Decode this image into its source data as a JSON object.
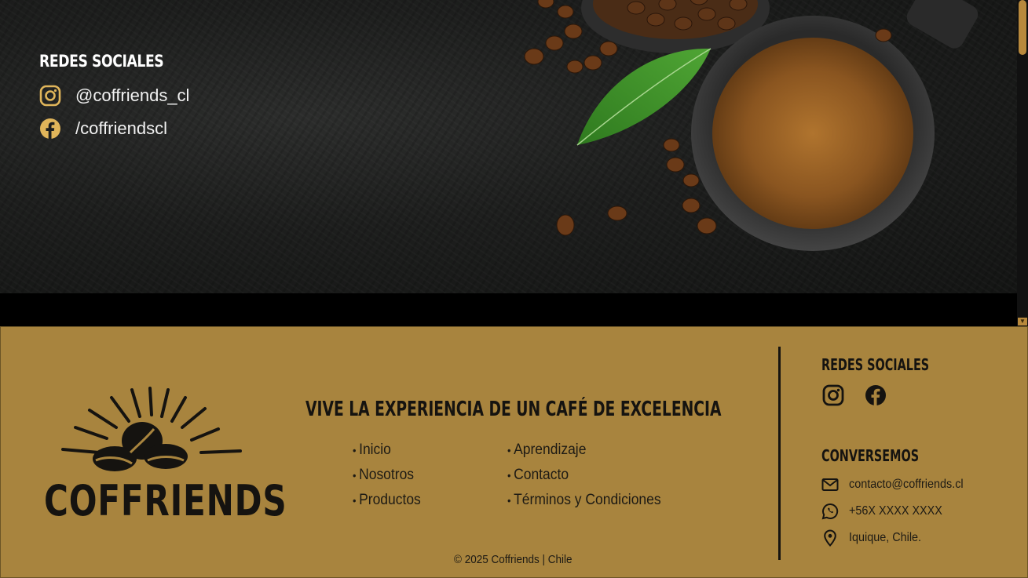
{
  "hero": {
    "social_heading": "REDES SOCIALES",
    "instagram_handle": "@coffriends_cl",
    "facebook_handle": "/coffriendscl"
  },
  "footer": {
    "brand_name": "COFFRIENDS",
    "tagline": "VIVE LA EXPERIENCIA DE UN CAFÉ DE EXCELENCIA",
    "nav_col1": [
      "Inicio",
      "Nosotros",
      "Productos"
    ],
    "nav_col2": [
      "Aprendizaje",
      "Contacto",
      "Términos y Condiciones"
    ],
    "copyright": "© 2025 Coffriends | Chile",
    "social_heading": "REDES SOCIALES",
    "contact_heading": "CONVERSEMOS",
    "email": "contacto@coffriends.cl",
    "phone": "+56X XXXX XXXX",
    "location": "Iquique, Chile."
  },
  "colors": {
    "accent_gold": "#a8843e",
    "hero_background": "#1d1e1d",
    "icon_gold": "#e0b55a",
    "text_dark": "#151310"
  },
  "icons": [
    "instagram-icon",
    "facebook-icon",
    "mail-icon",
    "whatsapp-icon",
    "location-pin-icon"
  ]
}
